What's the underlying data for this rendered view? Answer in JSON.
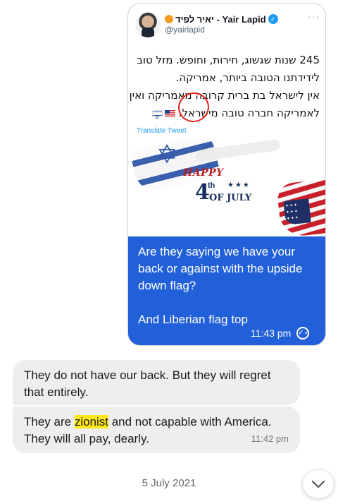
{
  "thread": {
    "outgoing": {
      "tweet": {
        "author_name": "יאיר לפיד - Yair Lapid",
        "handle": "@yairlapid",
        "more": "···",
        "text_lines": [
          "245 שנות שגשוג, חירות, וחופש. מזל טוב",
          "לידידתנו הטובה ביותר, אמריקה.",
          "אין לישראל בת ברית קרובה מאמריקה ואין",
          "לאמריקה חברה טובה מישראל."
        ],
        "translate_label": "Translate Tweet",
        "image_text": {
          "happy": "HAPPY",
          "four": "4",
          "th": "th",
          "stars": "★★★",
          "of_july": "OF JULY"
        }
      },
      "message_paragraphs": [
        "Are they saying we have your back or against with the upside down flag?",
        "And Liberian flag top"
      ],
      "time": "11:43 pm",
      "read_icon": "double-check-icon",
      "bubble_color": "#2260d9"
    },
    "incoming": [
      {
        "text": "They do not have our back. But they will regret that entirely."
      },
      {
        "text_before": "They are ",
        "highlight": "zionist",
        "text_after": " and not capable with America. They will all pay, dearly.",
        "time": "11:42 pm",
        "highlight_color": "#ffe81a"
      }
    ],
    "date_separator": "5 July 2021",
    "scroll_button_icon": "chevron-down-icon"
  }
}
